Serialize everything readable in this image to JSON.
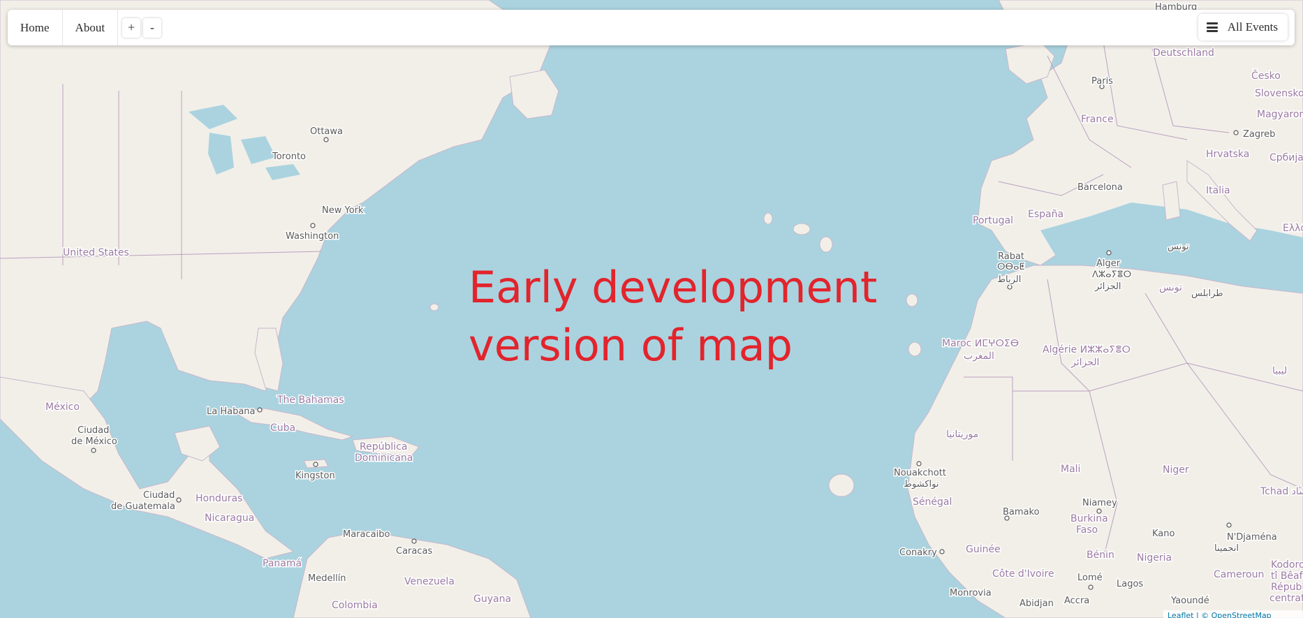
{
  "nav": {
    "home": "Home",
    "about": "About",
    "zoom_in": "+",
    "zoom_out": "-"
  },
  "events": {
    "label": "All Events",
    "icon": "menu-icon"
  },
  "overlay": {
    "line1": "Early development",
    "line2": "version of map"
  },
  "attribution": "Leaflet | © OpenStreetMap",
  "colors": {
    "water": "#aad3df",
    "land": "#f2efe9",
    "border": "#9b7aa3",
    "overlay_text": "#e2242c"
  },
  "map_labels": {
    "ottawa": "Ottawa",
    "toronto": "Toronto",
    "new_york": "New York",
    "washington": "Washington",
    "united_states": "United States",
    "mexico": "México",
    "ciudad_mexico_1": "Ciudad",
    "ciudad_mexico_2": "de México",
    "la_habana": "La Habana",
    "bahamas": "The Bahamas",
    "cuba": "Cuba",
    "kingston": "Kingston",
    "republica_1": "República",
    "republica_2": "Dominicana",
    "ciudad_guatemala_1": "Ciudad",
    "ciudad_guatemala_2": "de Guatemala",
    "honduras": "Honduras",
    "nicaragua": "Nicaragua",
    "panama": "Panamá",
    "maracaibo": "Maracaibo",
    "caracas": "Caracas",
    "medellin": "Medellín",
    "venezuela": "Venezuela",
    "colombia": "Colombia",
    "guyana": "Guyana",
    "hamburg": "Hamburg",
    "deutschland": "Deutschland",
    "cesko": "Česko",
    "paris": "Paris",
    "france": "France",
    "slovensko": "Slovensko",
    "magyarorszag": "Magyarország",
    "zagreb": "Zagreb",
    "hrvatska": "Hrvatska",
    "srbija": "Србија",
    "barcelona": "Barcelona",
    "italia": "Italia",
    "ellada": "Ελλά",
    "portugal": "Portugal",
    "espana": "España",
    "rabat_1": "Rabat",
    "rabat_2": "ⵔⴱⴰⵟ",
    "rabat_3": "الرباط",
    "alger_1": "Alger",
    "alger_2": "ⴷⵣⴰⵢⴻⵔ",
    "alger_3": "الجزائر",
    "tunis_ar": "تونس",
    "tunis_ar2": "تونس",
    "tripoli_ar": "طرابلس",
    "maroc_1": "Maroc ⵍⵎⵖⵔⵉⴱ",
    "maroc_2": "المغرب",
    "algerie_1": "Algérie ⵍⵣⵣⴰⵢⴻⵔ",
    "algerie_2": "الجزائر",
    "libya": "ليبيا",
    "mauritania": "موريتانيا",
    "mali": "Mali",
    "niger": "Niger",
    "tchad": "Tchad تشاد",
    "nouakchott_1": "Nouakchott",
    "nouakchott_2": "نواكشوط",
    "senegal": "Sénégal",
    "bamako": "Bamako",
    "niamey": "Niamey",
    "burkina_1": "Burkina",
    "burkina_2": "Faso",
    "kano": "Kano",
    "ndjamena_1": "N'Djaména",
    "ndjamena_2": "انجمينا",
    "conakry": "Conakry",
    "guinee": "Guinée",
    "benin": "Bénin",
    "nigeria": "Nigeria",
    "cote_divoire": "Côte d'Ivoire",
    "lome": "Lomé",
    "lagos": "Lagos",
    "cameroun": "Cameroun",
    "kodorose_1": "Kodorosè",
    "kodorose_2": "tî Bêafrîka",
    "kodorose_3": "Républiqu",
    "kodorose_4": "centrafrica",
    "monrovia": "Monrovia",
    "abidjan": "Abidjan",
    "accra": "Accra",
    "yaounde": "Yaoundé"
  }
}
